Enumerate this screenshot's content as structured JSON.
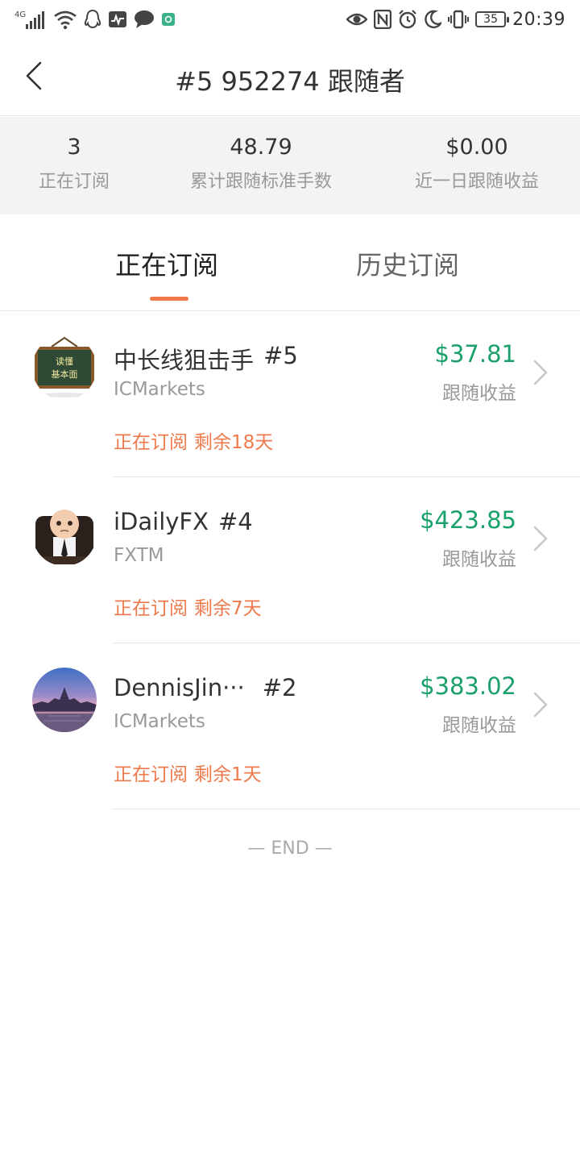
{
  "status_bar": {
    "network": "4G",
    "battery": "35",
    "time": "20:39",
    "left_icons": [
      "signal-icon",
      "wifi-icon",
      "qq-icon",
      "activity-icon",
      "chat-icon",
      "app-icon"
    ],
    "right_icons": [
      "eye-icon",
      "nfc-icon",
      "alarm-icon",
      "moon-icon",
      "vibrate-icon"
    ]
  },
  "header": {
    "title": "#5 952274 跟随者",
    "back_icon": "chevron-left-icon"
  },
  "summary": {
    "subscribing_count": "3",
    "subscribing_label": "正在订阅",
    "total_lots": "48.79",
    "total_lots_label": "累计跟随标准手数",
    "daily_profit": "$0.00",
    "daily_profit_label": "近一日跟随收益"
  },
  "tabs": [
    {
      "label": "正在订阅",
      "active": true
    },
    {
      "label": "历史订阅",
      "active": false
    }
  ],
  "subscriptions": [
    {
      "name": "中长线狙击手",
      "number": "#5",
      "broker": "ICMarkets",
      "profit": "$37.81",
      "profit_label": "跟随收益",
      "status": "正在订阅",
      "remaining": "剩余18天",
      "avatar_icon": "chalkboard-avatar-icon"
    },
    {
      "name": "iDailyFX",
      "number": "#4",
      "broker": "FXTM",
      "profit": "$423.85",
      "profit_label": "跟随收益",
      "status": "正在订阅",
      "remaining": "剩余7天",
      "avatar_icon": "baby-boss-avatar-icon"
    },
    {
      "name": "DennisJin···",
      "number": "#2",
      "broker": "ICMarkets",
      "profit": "$383.02",
      "profit_label": "跟随收益",
      "status": "正在订阅",
      "remaining": "剩余1天",
      "avatar_icon": "landscape-avatar-icon"
    }
  ],
  "end_text": "— END —",
  "colors": {
    "accent": "#ee7a4c",
    "profit": "#1aa06a",
    "summary_bg": "#f3f3f3"
  }
}
